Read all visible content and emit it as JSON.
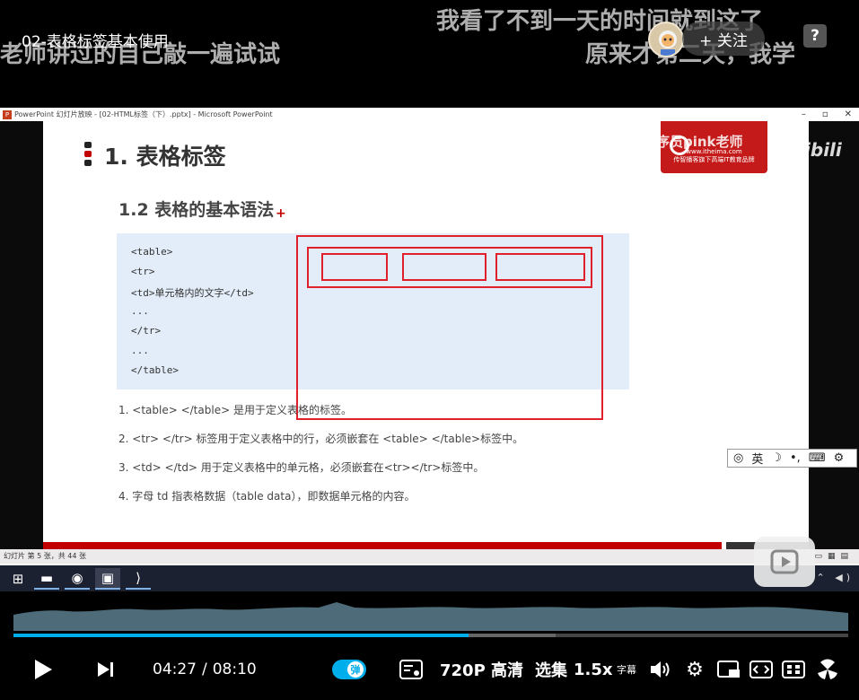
{
  "video": {
    "title": "02-表格标签基本使用",
    "danmaku": [
      "老师讲过的自己敲一遍试试",
      "我看了不到一天的时间就到这了",
      "原来才第二天，我学"
    ],
    "follow_label": "+ 关注",
    "help_label": "?"
  },
  "powerpoint": {
    "window_title": "PowerPoint 幻灯片放映 - [02-HTML标签（下）.pptx] - Microsoft PowerPoint",
    "logo": "P",
    "controls": [
      "–",
      "▫",
      "✕"
    ],
    "status": "幻灯片 第 5 张，共 44 张"
  },
  "slide": {
    "heading": "1. 表格标签",
    "subheading": "1.2 表格的基本语法",
    "brand_text": "传智播客旗下高端IT教育品牌",
    "brand_url": "www.itheima.com",
    "watermark": "黑马程序员pink老师",
    "bili_mark": "bilibili",
    "code_lines": [
      "<table>",
      "  <tr>",
      "    <td>单元格内的文字</td>",
      "    ...",
      "  </tr>",
      "  ...",
      "</table>"
    ],
    "list_items": [
      "1.  <table> </table> 是用于定义表格的标签。",
      "2.  <tr> </tr> 标签用于定义表格中的行，必须嵌套在 <table> </table>标签中。",
      "3.  <td> </td> 用于定义表格中的单元格，必须嵌套在<tr></tr>标签中。",
      "4.  字母 td 指表格数据（table data），即数据单元格的内容。"
    ]
  },
  "ime": {
    "label": "英"
  },
  "player": {
    "current_time": "04:27",
    "separator": "/",
    "duration": "08:10",
    "played_fraction": 0.545,
    "danmaku_icon": "弹",
    "quality": "720P 高清",
    "episodes": "选集",
    "speed": "1.5x",
    "subtitle_icon": "字幕"
  }
}
